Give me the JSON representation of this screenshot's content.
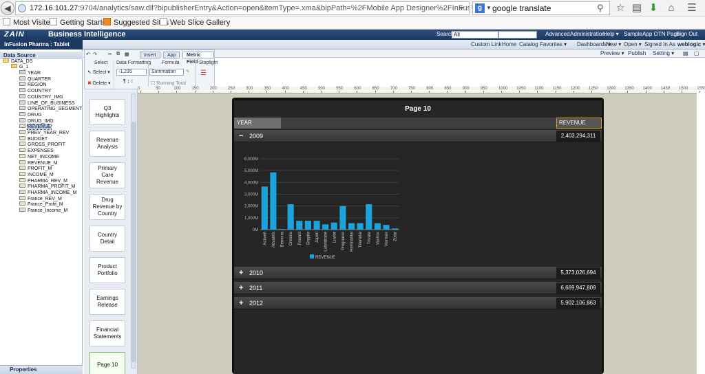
{
  "browser": {
    "url_host": "172.16.101.27",
    "url_rest": ":9704/analytics/saw.dll?bipublisherEntry&Action=open&itemType=.xma&bipPath=%2FMobile App Designer%2FInFusion Pharma.xma&pat",
    "search_text": "google translate",
    "search_engine_letter": "g",
    "bookmarks": [
      "Most Visited",
      "Getting Started",
      "Suggested Sites",
      "Web Slice Gallery"
    ]
  },
  "obiee": {
    "logo": "ZAIN",
    "title": "Business Intelligence",
    "search_label": "Search",
    "search_scope": "All",
    "header_links": [
      "Advanced",
      "Administration",
      "Help ▾",
      "SampleApp OTN Page",
      "Sign Out"
    ],
    "nav_links": [
      "Custom Link",
      "Home",
      "Catalog",
      "Favorites ▾",
      "Dashboards ▾",
      "New ▾",
      "Open ▾",
      "Signed In As"
    ],
    "signed_in_user": "weblogic ▾",
    "tool_links": [
      "Preview ▾",
      "Publish",
      "Setting ▾"
    ],
    "doc_tab": "InFusion Pharma : Tablet"
  },
  "datasource": {
    "title": "Data Source",
    "root": "DATA_DS",
    "group": "G_1",
    "fields": [
      "YEAR",
      "QUARTER",
      "REGION",
      "COUNTRY",
      "COUNTRY_IMG",
      "LINE_OF_BUSINESS",
      "OPERATING_SEGMENT",
      "DRUG",
      "DRUG_IMG",
      "REVENUE",
      "PREV_YEAR_REV",
      "BUDGET",
      "GROSS_PROFIT",
      "EXPENSES",
      "NET_INCOME",
      "REVENUE_M",
      "PROFIT_M",
      "INCOME_M",
      "PHARMA_REV_M",
      "PHARMA_PROFIT_M",
      "PHARMA_INCOME_M",
      "France_REV_M",
      "France_Profit_M",
      "France_Income_M"
    ],
    "selected_field": "REVENUE",
    "properties_label": "Properties"
  },
  "ribbon": {
    "tabs": [
      "Insert",
      "App",
      "Metric Field"
    ],
    "active_tab": "Metric Field",
    "groups": [
      "Select",
      "Data Formatting",
      "Formula",
      "Stoplight"
    ],
    "select_label": "Select",
    "delete_label": "Delete",
    "format_value": "-1,235",
    "formula_value": "Summation",
    "running_total": "Running Total"
  },
  "pages": [
    "Q3 Highlights",
    "Revenue Analysis",
    "Primary Care Revenue",
    "Drug Revenue by Country",
    "Country Detail",
    "Product Portfolio",
    "Earnings Release",
    "Financial Statements",
    "Page 10"
  ],
  "active_page": "Page 10",
  "ruler": [
    "0",
    "50",
    "100",
    "150",
    "200",
    "250",
    "300",
    "350",
    "400",
    "450",
    "500",
    "550",
    "600",
    "650",
    "700",
    "750",
    "800",
    "850",
    "900",
    "950",
    "1000",
    "1050",
    "1100",
    "1150",
    "1200",
    "1250",
    "1300",
    "1350",
    "1400",
    "1450",
    "1500",
    "1550"
  ],
  "report": {
    "page_title": "Page 10",
    "col_year": "YEAR",
    "col_revenue": "REVENUE",
    "rows": [
      {
        "toggle": "−",
        "year": "2009",
        "revenue": "2,403,294,311"
      },
      {
        "toggle": "+",
        "year": "2010",
        "revenue": "5,373,026,694"
      },
      {
        "toggle": "+",
        "year": "2011",
        "revenue": "6,669,947,809"
      },
      {
        "toggle": "+",
        "year": "2012",
        "revenue": "5,902,106,863"
      }
    ]
  },
  "chart_data": {
    "type": "bar",
    "title": "",
    "xlabel": "",
    "ylabel": "",
    "categories": [
      "Activeft",
      "Advantis",
      "Benexra",
      "Cressia",
      "Fravinil",
      "Gryptia",
      "Japeri",
      "Lubridrane",
      "Luvior",
      "Pregnanix",
      "Remnantal",
      "Trientrial",
      "Trivate",
      "Vaxmix",
      "Voxmex",
      "Zolar"
    ],
    "series": [
      {
        "name": "REVENUE",
        "color": "#1aa3dd",
        "values": [
          3650,
          4850,
          50,
          2150,
          750,
          750,
          750,
          450,
          600,
          2000,
          550,
          550,
          2150,
          550,
          400,
          100
        ]
      }
    ],
    "y_ticks": [
      "0M",
      "1,000M",
      "2,000M",
      "3,000M",
      "4,000M",
      "5,000M",
      "6,000M"
    ],
    "ylim": [
      0,
      6000
    ],
    "grid": true,
    "legend": "bottom"
  }
}
